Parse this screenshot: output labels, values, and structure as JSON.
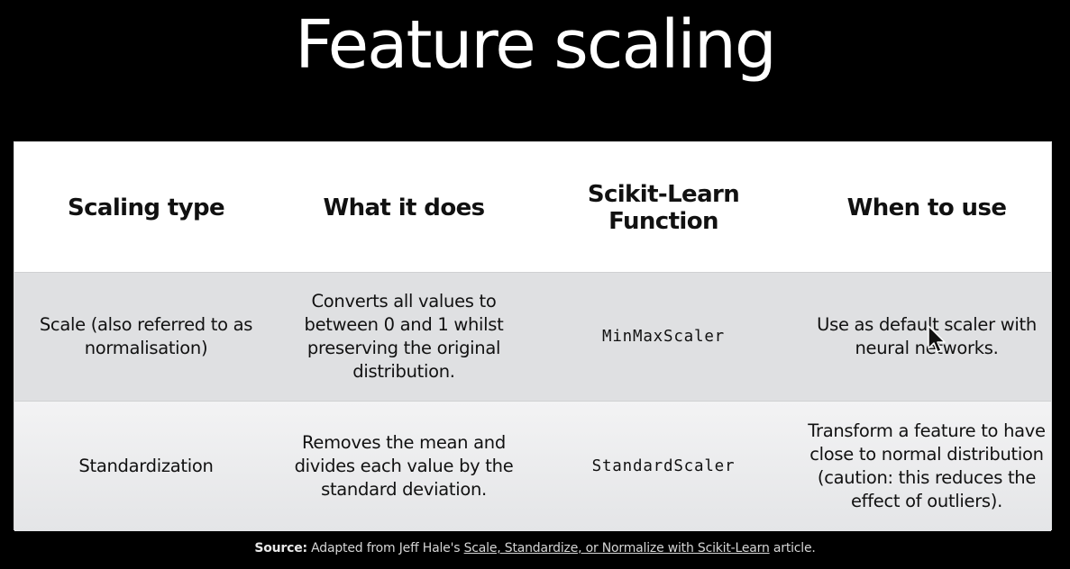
{
  "title": "Feature scaling",
  "table": {
    "headers": [
      "Scaling type",
      "What it does",
      "Scikit-Learn Function",
      "When to use"
    ],
    "rows": [
      {
        "scaling_type": "Scale (also referred to as normalisation)",
        "what_it_does": "Converts all values to between 0 and 1 whilst preserving the original distribution.",
        "function": "MinMaxScaler",
        "when_to_use": "Use as default scaler with neural networks."
      },
      {
        "scaling_type": "Standardization",
        "what_it_does": "Removes the mean and divides each value by the standard deviation.",
        "function": "StandardScaler",
        "when_to_use": "Transform a feature to have close to normal distribution (caution: this reduces the effect of outliers)."
      }
    ]
  },
  "footer": {
    "source_label": "Source:",
    "text_before": "Adapted from Jeff Hale's",
    "link_text": "Scale, Standardize, or Normalize with Scikit-Learn",
    "text_after": "article."
  },
  "icons": {
    "cursor": "mouse-pointer-icon"
  },
  "colors": {
    "background": "#000000",
    "title": "#ffffff",
    "row_shaded": "#dfe0e2",
    "row_light": "#f3f3f4"
  }
}
